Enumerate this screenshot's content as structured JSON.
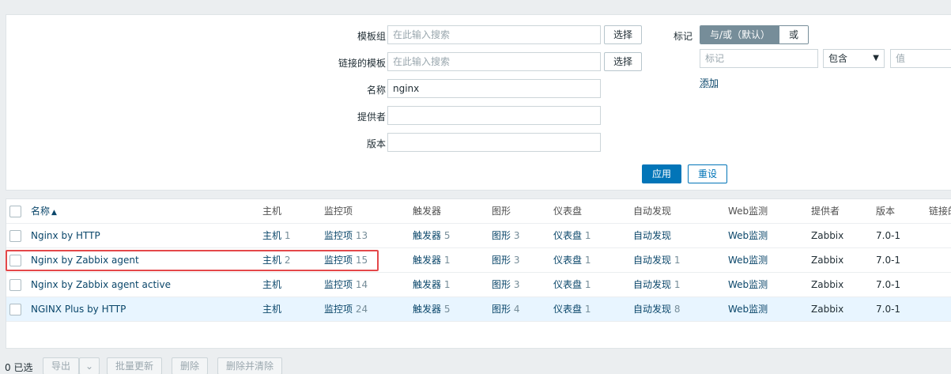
{
  "filter": {
    "template_group_label": "模板组",
    "template_group_placeholder": "在此输入搜索",
    "linked_templates_label": "链接的模板",
    "linked_templates_placeholder": "在此输入搜索",
    "select_label": "选择",
    "name_label": "名称",
    "name_value": "nginx",
    "vendor_label": "提供者",
    "vendor_value": "",
    "version_label": "版本",
    "version_value": "",
    "tags_label": "标记",
    "tags_and_or": "与/或（默认）",
    "tags_or": "或",
    "tag_placeholder": "标记",
    "tag_operator": "包含",
    "tag_value_placeholder": "值",
    "add_label": "添加",
    "apply_label": "应用",
    "reset_label": "重设"
  },
  "table": {
    "headers": {
      "name": "名称",
      "hosts": "主机",
      "items": "监控项",
      "triggers": "触发器",
      "graphs": "图形",
      "dashboards": "仪表盘",
      "discovery": "自动发现",
      "web": "Web监测",
      "vendor": "提供者",
      "version": "版本",
      "linked": "链接的"
    },
    "rows": [
      {
        "name": "Nginx by HTTP",
        "hosts": "主机",
        "hosts_n": "1",
        "items": "监控项",
        "items_n": "13",
        "triggers": "触发器",
        "triggers_n": "5",
        "graphs": "图形",
        "graphs_n": "3",
        "dashboards": "仪表盘",
        "dashboards_n": "1",
        "discovery": "自动发现",
        "discovery_n": "",
        "web": "Web监测",
        "vendor": "Zabbix",
        "version": "7.0-1"
      },
      {
        "name": "Nginx by Zabbix agent",
        "hosts": "主机",
        "hosts_n": "2",
        "items": "监控项",
        "items_n": "15",
        "triggers": "触发器",
        "triggers_n": "1",
        "graphs": "图形",
        "graphs_n": "3",
        "dashboards": "仪表盘",
        "dashboards_n": "1",
        "discovery": "自动发现",
        "discovery_n": "1",
        "web": "Web监测",
        "vendor": "Zabbix",
        "version": "7.0-1"
      },
      {
        "name": "Nginx by Zabbix agent active",
        "hosts": "主机",
        "hosts_n": "",
        "items": "监控项",
        "items_n": "14",
        "triggers": "触发器",
        "triggers_n": "1",
        "graphs": "图形",
        "graphs_n": "3",
        "dashboards": "仪表盘",
        "dashboards_n": "1",
        "discovery": "自动发现",
        "discovery_n": "1",
        "web": "Web监测",
        "vendor": "Zabbix",
        "version": "7.0-1"
      },
      {
        "name": "NGINX Plus by HTTP",
        "hosts": "主机",
        "hosts_n": "",
        "items": "监控项",
        "items_n": "24",
        "triggers": "触发器",
        "triggers_n": "5",
        "graphs": "图形",
        "graphs_n": "4",
        "dashboards": "仪表盘",
        "dashboards_n": "1",
        "discovery": "自动发现",
        "discovery_n": "8",
        "web": "Web监测",
        "vendor": "Zabbix",
        "version": "7.0-1"
      }
    ]
  },
  "footer": {
    "selected": "0 已选",
    "export": "导出",
    "mass_update": "批量更新",
    "delete": "删除",
    "delete_clear": "删除并清除"
  },
  "colors": {
    "link": "#0a466a",
    "primary": "#0275b8",
    "highlight": "#e4484a",
    "row_hover": "#e8f5ff"
  }
}
